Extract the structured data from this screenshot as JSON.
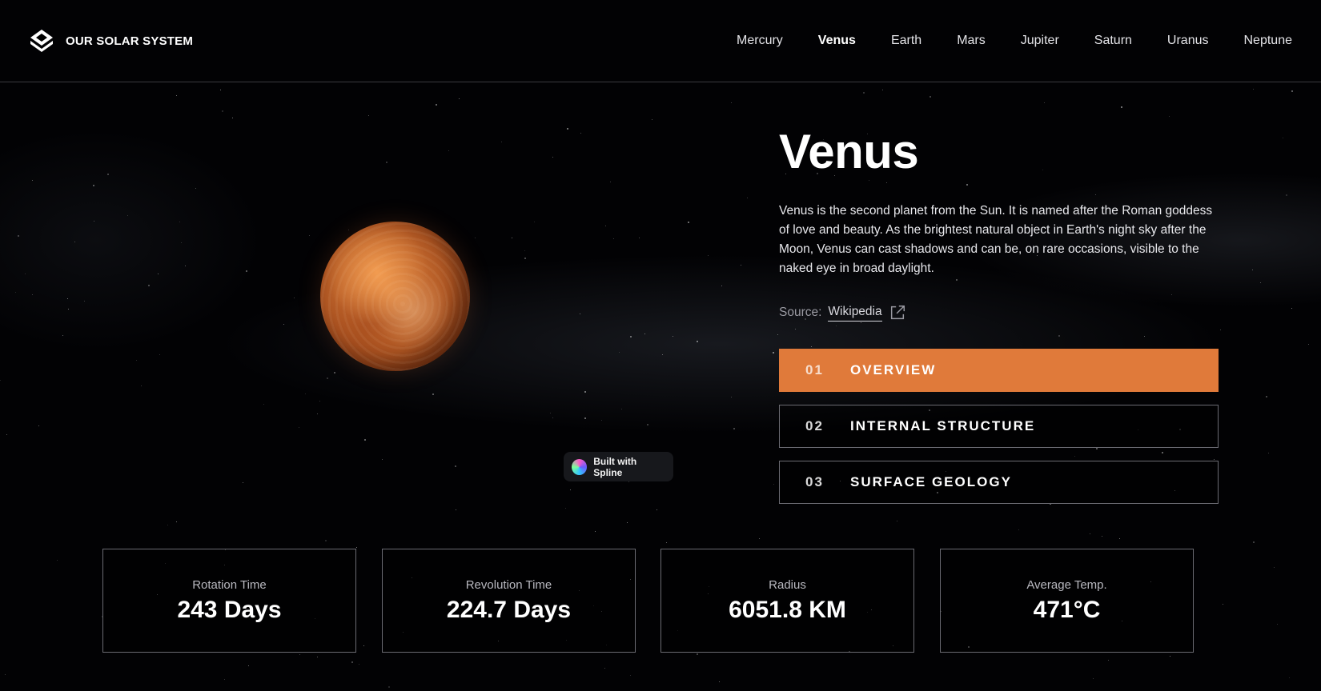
{
  "header": {
    "brand": "OUR SOLAR SYSTEM",
    "nav": [
      {
        "label": "Mercury",
        "active": false
      },
      {
        "label": "Venus",
        "active": true
      },
      {
        "label": "Earth",
        "active": false
      },
      {
        "label": "Mars",
        "active": false
      },
      {
        "label": "Jupiter",
        "active": false
      },
      {
        "label": "Saturn",
        "active": false
      },
      {
        "label": "Uranus",
        "active": false
      },
      {
        "label": "Neptune",
        "active": false
      }
    ]
  },
  "badge": {
    "label": "Built with Spline"
  },
  "planet": {
    "name": "Venus",
    "description": "Venus is the second planet from the Sun. It is named after the Roman goddess of love and beauty. As the brightest natural object in Earth's night sky after the Moon, Venus can cast shadows and can be, on rare occasions, visible to the naked eye in broad daylight.",
    "source_label": "Source:",
    "source_link": "Wikipedia"
  },
  "tabs": [
    {
      "num": "01",
      "label": "OVERVIEW",
      "active": true
    },
    {
      "num": "02",
      "label": "INTERNAL STRUCTURE",
      "active": false
    },
    {
      "num": "03",
      "label": "SURFACE GEOLOGY",
      "active": false
    }
  ],
  "stats": [
    {
      "label": "Rotation Time",
      "value": "243 Days"
    },
    {
      "label": "Revolution Time",
      "value": "224.7 Days"
    },
    {
      "label": "Radius",
      "value": "6051.8 KM"
    },
    {
      "label": "Average Temp.",
      "value": "471°C"
    }
  ],
  "colors": {
    "accent": "#e07a3a",
    "background": "#020204",
    "border": "#6b6b72"
  }
}
